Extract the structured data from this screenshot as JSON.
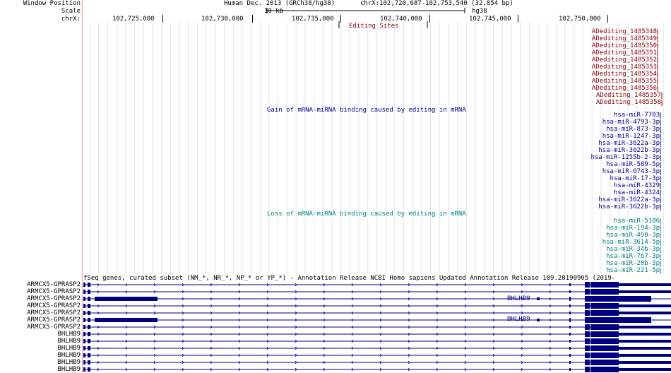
{
  "header": {
    "window_position_label": "Window Position",
    "scale_label": "Scale",
    "chrom_label": "chrX:",
    "assembly_text": "Human Dec. 2013 (GRCh38/hg38)",
    "position_text": "chrX:102,720,687-102,753,540 (32,854 bp)",
    "scale_value": "10 kb",
    "scale_assembly": "hg38",
    "ticks": [
      "102,725,000",
      "102,730,000",
      "102,735,000",
      "102,740,000",
      "102,745,000",
      "102,750,000"
    ]
  },
  "tracks": {
    "editing": {
      "title": "Editing Sites",
      "items": [
        "ADediting_1485348",
        "ADediting_1485349",
        "ADediting_1485350",
        "ADediting_1485351",
        "ADediting_1485352",
        "ADediting_1485353",
        "ADediting_1485354",
        "ADediting_1485355",
        "ADediting_1485356",
        "ADediting_1485357",
        "ADediting_1485358"
      ]
    },
    "gain": {
      "title": "Gain of mRNA-miRNA binding caused by editing in mRNA",
      "items": [
        "hsa-miR-7703",
        "hsa-miR-4793-3p",
        "hsa-miR-873-3p",
        "hsa-miR-1247-3p",
        "hsa-miR-3622a-3p",
        "hsa-miR-3622b-3p",
        "hsa-miR-1255b-2-3p",
        "hsa-miR-589-5p",
        "hsa-miR-6743-3p",
        "hsa-miR-17-3p",
        "hsa-miR-4329",
        "hsa-miR-4324",
        "hsa-miR-3622a-3p",
        "hsa-miR-3622b-3p"
      ]
    },
    "loss": {
      "title": "Loss of mRNA-miRNA binding caused by editing in mRNA",
      "items": [
        "hsa-miR-5186",
        "hsa-miR-194-3p",
        "hsa-miR-490-3p",
        "hsa-miR-3614-5p",
        "hsa-miR-34b-3p",
        "hsa-miR-767-3p",
        "hsa-miR-20b-3p",
        "hsa-miR-221-5p"
      ]
    },
    "genes": {
      "title": "fSeq genes, curated subset (NM_*, NR_*, NP_* or YP_*) - Annotation Release NCBI Homo sapiens Updated Annotation Release 109.20190905 (2019-",
      "rows": [
        "ARMCX5-GPRASP2",
        "ARMCX5-GPRASP2",
        "ARMCX5-GPRASP2",
        "ARMCX5-GPRASP2",
        "ARMCX5-GPRASP2",
        "ARMCX5-GPRASP2",
        "ARMCX5-GPRASP2",
        "BHLHB9",
        "BHLHB9",
        "BHLHB9",
        "BHLHB9",
        "BHLHB9",
        "BHLHB9",
        "BHLHB9"
      ],
      "inline_label": "BHLHB9"
    }
  },
  "colors": {
    "editing": "#8b0000",
    "gain": "#00008b",
    "loss": "#008080",
    "gene": "#000080",
    "grid": "#dde4ee",
    "border": "#ff9999"
  }
}
